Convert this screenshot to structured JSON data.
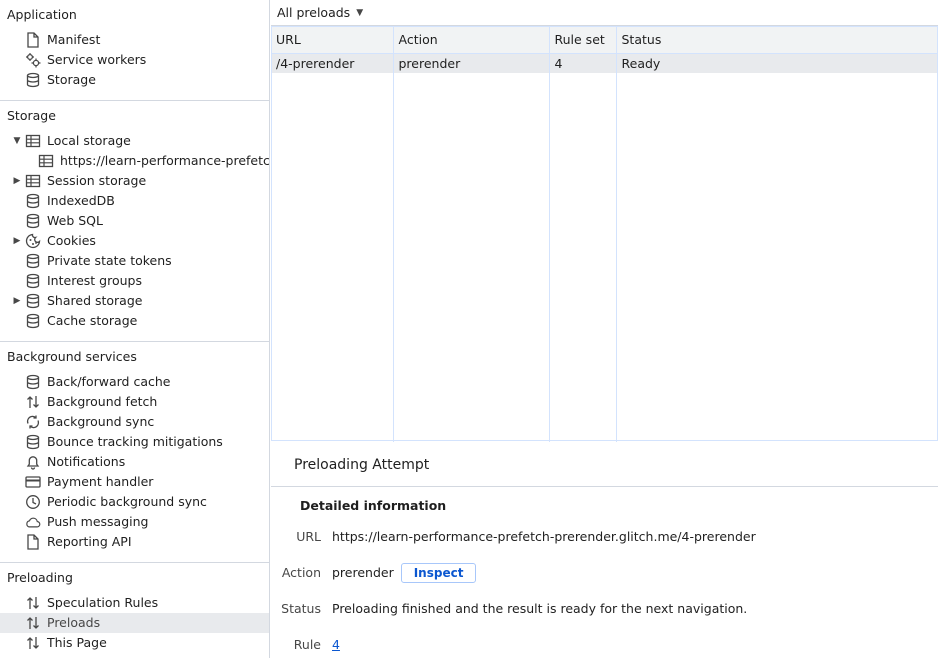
{
  "sidebar": {
    "sections": [
      {
        "title": "Application",
        "items": [
          {
            "label": "Manifest",
            "icon": "document-icon"
          },
          {
            "label": "Service workers",
            "icon": "gears-icon"
          },
          {
            "label": "Storage",
            "icon": "database-icon"
          }
        ]
      },
      {
        "title": "Storage",
        "items": [
          {
            "label": "Local storage",
            "icon": "table-icon",
            "expanded": true
          },
          {
            "label": "https://learn-performance-prefetch-prerender.glitch.me",
            "icon": "table-icon",
            "child": true
          },
          {
            "label": "Session storage",
            "icon": "table-icon",
            "collapsed": true
          },
          {
            "label": "IndexedDB",
            "icon": "database-icon"
          },
          {
            "label": "Web SQL",
            "icon": "database-icon"
          },
          {
            "label": "Cookies",
            "icon": "cookie-icon",
            "collapsed": true
          },
          {
            "label": "Private state tokens",
            "icon": "database-icon"
          },
          {
            "label": "Interest groups",
            "icon": "database-icon"
          },
          {
            "label": "Shared storage",
            "icon": "database-icon",
            "collapsed": true
          },
          {
            "label": "Cache storage",
            "icon": "database-icon"
          }
        ]
      },
      {
        "title": "Background services",
        "items": [
          {
            "label": "Back/forward cache",
            "icon": "database-icon"
          },
          {
            "label": "Background fetch",
            "icon": "arrows-up-down-icon"
          },
          {
            "label": "Background sync",
            "icon": "sync-icon"
          },
          {
            "label": "Bounce tracking mitigations",
            "icon": "database-icon"
          },
          {
            "label": "Notifications",
            "icon": "bell-icon"
          },
          {
            "label": "Payment handler",
            "icon": "credit-card-icon"
          },
          {
            "label": "Periodic background sync",
            "icon": "clock-icon"
          },
          {
            "label": "Push messaging",
            "icon": "cloud-icon"
          },
          {
            "label": "Reporting API",
            "icon": "document-icon"
          }
        ]
      },
      {
        "title": "Preloading",
        "items": [
          {
            "label": "Speculation Rules",
            "icon": "arrows-up-down-icon"
          },
          {
            "label": "Preloads",
            "icon": "arrows-up-down-icon",
            "selected": true
          },
          {
            "label": "This Page",
            "icon": "arrows-up-down-icon"
          }
        ]
      }
    ]
  },
  "filter": {
    "label": "All preloads"
  },
  "grid": {
    "columns": [
      "URL",
      "Action",
      "Rule set",
      "Status"
    ],
    "rows": [
      {
        "url": "/4-prerender",
        "action": "prerender",
        "rule_set": "4",
        "status": "Ready"
      }
    ]
  },
  "details": {
    "title": "Preloading Attempt",
    "subtitle": "Detailed information",
    "url_key": "URL",
    "url_value": "https://learn-performance-prefetch-prerender.glitch.me/4-prerender",
    "action_key": "Action",
    "action_value": "prerender",
    "inspect_label": "Inspect",
    "status_key": "Status",
    "status_value": "Preloading finished and the result is ready for the next navigation.",
    "ruleset_key": "Rule set",
    "ruleset_value": "4"
  }
}
